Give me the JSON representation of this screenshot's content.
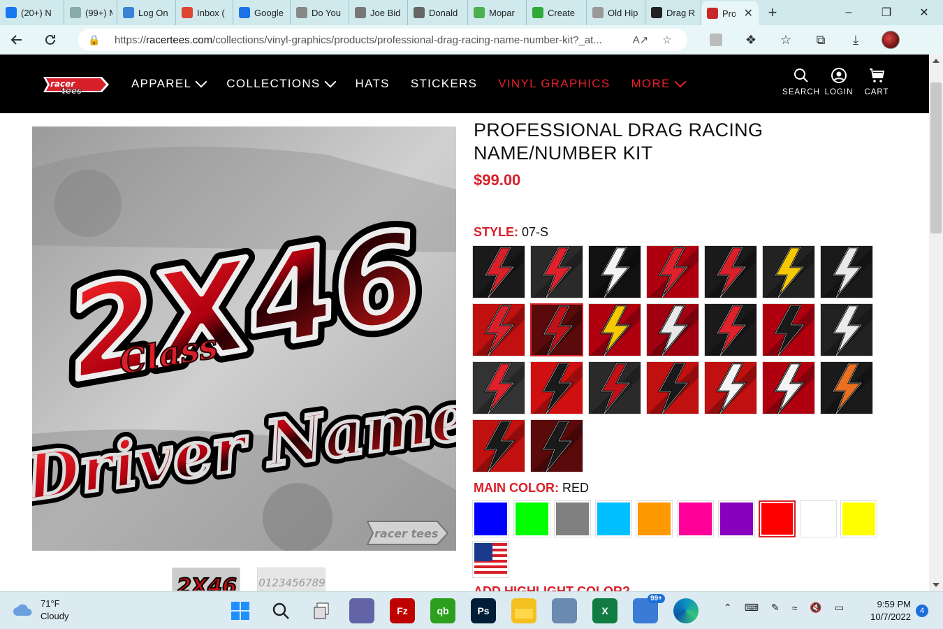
{
  "browser": {
    "tabs": [
      {
        "title": "(20+) N",
        "icon": "facebook-icon",
        "color": "#1877f2"
      },
      {
        "title": "(99+) M",
        "icon": "dots-icon",
        "color": "#8aa"
      },
      {
        "title": "Log On",
        "icon": "asterisk-icon",
        "color": "#3b82d6"
      },
      {
        "title": "Inbox (",
        "icon": "gmail-icon",
        "color": "#e04433"
      },
      {
        "title": "Google",
        "icon": "calendar-icon",
        "color": "#1a73e8"
      },
      {
        "title": "Do You",
        "icon": "person-icon",
        "color": "#888"
      },
      {
        "title": "Joe Bid",
        "icon": "person-icon",
        "color": "#777"
      },
      {
        "title": "Donald",
        "icon": "person-icon",
        "color": "#666"
      },
      {
        "title": "Mopar",
        "icon": "mopar-icon",
        "color": "#4caf50"
      },
      {
        "title": "Create",
        "icon": "create-icon",
        "color": "#2eaa3a"
      },
      {
        "title": "Old Hip",
        "icon": "person-icon",
        "color": "#999"
      },
      {
        "title": "Drag R",
        "icon": "drag-icon",
        "color": "#222"
      }
    ],
    "active_tab": {
      "title": "Pro",
      "icon": "racertees-icon",
      "color": "#c62828"
    },
    "url_prefix": "https://",
    "url_domain": "racertees.com",
    "url_path": "/collections/vinyl-graphics/products/professional-drag-racing-name-number-kit?_at..."
  },
  "site": {
    "nav": [
      {
        "label": "APPAREL",
        "dropdown": true,
        "red": false
      },
      {
        "label": "COLLECTIONS",
        "dropdown": true,
        "red": false
      },
      {
        "label": "HATS",
        "dropdown": false,
        "red": false
      },
      {
        "label": "STICKERS",
        "dropdown": false,
        "red": false
      },
      {
        "label": "VINYL GRAPHICS",
        "dropdown": false,
        "red": true
      },
      {
        "label": "MORE",
        "dropdown": true,
        "red": true
      }
    ],
    "header_icons": {
      "search": "SEARCH",
      "login": "LOGIN",
      "cart": "CART"
    }
  },
  "product": {
    "title": "PROFESSIONAL DRAG RACING NAME/NUMBER KIT",
    "price": "$99.00",
    "image_main_text": "2X46",
    "image_sub_text": "Class",
    "image_name_text": "Driver Name",
    "thumb2_text": "0123456789",
    "style_label": "STYLE:",
    "style_value": "07-S",
    "style_selected_index": 8,
    "style_swatches": [
      {
        "bg": "#1a1a1a",
        "bolt": "#d8202a"
      },
      {
        "bg": "#2a2a2a",
        "bolt": "#e0202a"
      },
      {
        "bg": "#111",
        "bolt": "#f4f4f4"
      },
      {
        "bg": "#b00010",
        "bolt": "#e0202a"
      },
      {
        "bg": "#1a1a1a",
        "bolt": "#d8202a"
      },
      {
        "bg": "#222",
        "bolt": "#f5c800"
      },
      {
        "bg": "#1a1a1a",
        "bolt": "#e8e8e8"
      },
      {
        "bg": "#c01010",
        "bolt": "#d8202a"
      },
      {
        "bg": "#5a0a0a",
        "bolt": "#c01018"
      },
      {
        "bg": "#b00010",
        "bolt": "#f5c800"
      },
      {
        "bg": "#a00010",
        "bolt": "#e8e8e8"
      },
      {
        "bg": "#1a1a1a",
        "bolt": "#e0202a"
      },
      {
        "bg": "#b00010",
        "bolt": "#1a1a1a"
      },
      {
        "bg": "#222",
        "bolt": "#eaeaea"
      },
      {
        "bg": "#333",
        "bolt": "#e0202a"
      },
      {
        "bg": "#d01010",
        "bolt": "#1a1a1a"
      },
      {
        "bg": "#2a2a2a",
        "bolt": "#c01018"
      },
      {
        "bg": "#c01010",
        "bolt": "#1a1a1a"
      },
      {
        "bg": "#c01010",
        "bolt": "#f4f4f4"
      },
      {
        "bg": "#b00010",
        "bolt": "#f4f4f4"
      },
      {
        "bg": "#1a1a1a",
        "bolt": "#e87020"
      },
      {
        "bg": "#c01010",
        "bolt": "#1a1a1a"
      },
      {
        "bg": "#5a0a0a",
        "bolt": "#1a1a1a"
      }
    ],
    "color_label": "MAIN COLOR:",
    "color_value": "RED",
    "color_selected_index": 7,
    "color_swatches": [
      {
        "name": "blue",
        "hex": "#0000ff"
      },
      {
        "name": "green",
        "hex": "#00ff00"
      },
      {
        "name": "gray",
        "hex": "#808080"
      },
      {
        "name": "light-blue",
        "hex": "#00bfff"
      },
      {
        "name": "orange",
        "hex": "#ff9900"
      },
      {
        "name": "pink",
        "hex": "#ff0099"
      },
      {
        "name": "purple",
        "hex": "#8800bb"
      },
      {
        "name": "red",
        "hex": "#ff0000"
      },
      {
        "name": "white",
        "hex": "#ffffff"
      },
      {
        "name": "yellow",
        "hex": "#ffff00"
      },
      {
        "name": "usa-flag",
        "hex": "flag"
      }
    ],
    "next_label_cutoff": "ADD HIGHLIGHT COLOR?"
  },
  "taskbar": {
    "temp": "71°F",
    "condition": "Cloudy",
    "time": "9:59 PM",
    "date": "10/7/2022",
    "notifications": "4",
    "badge": "99+",
    "apps": [
      {
        "name": "windows-start-icon",
        "label": "",
        "color": "#1e90ff"
      },
      {
        "name": "search-icon",
        "label": "",
        "color": "transparent"
      },
      {
        "name": "task-view-icon",
        "label": "",
        "color": "transparent"
      },
      {
        "name": "teams-icon",
        "label": "",
        "color": "#6264a7"
      },
      {
        "name": "filezilla-icon",
        "label": "Fz",
        "color": "#bf0000"
      },
      {
        "name": "quickbooks-icon",
        "label": "qb",
        "color": "#2ca01c"
      },
      {
        "name": "photoshop-icon",
        "label": "Ps",
        "color": "#001e36"
      },
      {
        "name": "file-explorer-icon",
        "label": "",
        "color": "#f4c020"
      },
      {
        "name": "keyboard-app-icon",
        "label": "",
        "color": "#6a8ab0"
      },
      {
        "name": "excel-icon",
        "label": "X",
        "color": "#107c41"
      },
      {
        "name": "dialpad-icon",
        "label": "",
        "color": "#3a7bd5"
      },
      {
        "name": "edge-icon",
        "label": "",
        "color": "#0c8ec2"
      }
    ]
  }
}
